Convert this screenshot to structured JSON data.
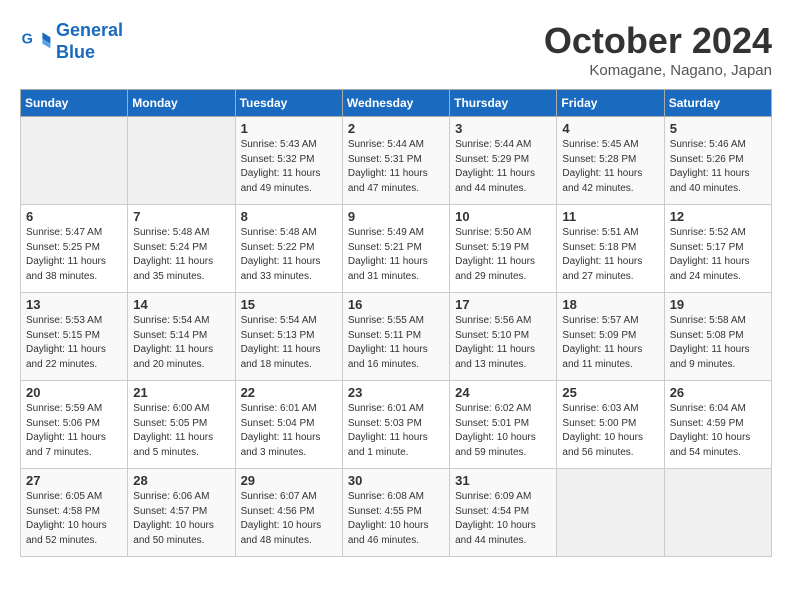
{
  "header": {
    "logo_line1": "General",
    "logo_line2": "Blue",
    "month_title": "October 2024",
    "location": "Komagane, Nagano, Japan"
  },
  "days_of_week": [
    "Sunday",
    "Monday",
    "Tuesday",
    "Wednesday",
    "Thursday",
    "Friday",
    "Saturday"
  ],
  "weeks": [
    [
      {
        "day": "",
        "content": ""
      },
      {
        "day": "",
        "content": ""
      },
      {
        "day": "1",
        "content": "Sunrise: 5:43 AM\nSunset: 5:32 PM\nDaylight: 11 hours\nand 49 minutes."
      },
      {
        "day": "2",
        "content": "Sunrise: 5:44 AM\nSunset: 5:31 PM\nDaylight: 11 hours\nand 47 minutes."
      },
      {
        "day": "3",
        "content": "Sunrise: 5:44 AM\nSunset: 5:29 PM\nDaylight: 11 hours\nand 44 minutes."
      },
      {
        "day": "4",
        "content": "Sunrise: 5:45 AM\nSunset: 5:28 PM\nDaylight: 11 hours\nand 42 minutes."
      },
      {
        "day": "5",
        "content": "Sunrise: 5:46 AM\nSunset: 5:26 PM\nDaylight: 11 hours\nand 40 minutes."
      }
    ],
    [
      {
        "day": "6",
        "content": "Sunrise: 5:47 AM\nSunset: 5:25 PM\nDaylight: 11 hours\nand 38 minutes."
      },
      {
        "day": "7",
        "content": "Sunrise: 5:48 AM\nSunset: 5:24 PM\nDaylight: 11 hours\nand 35 minutes."
      },
      {
        "day": "8",
        "content": "Sunrise: 5:48 AM\nSunset: 5:22 PM\nDaylight: 11 hours\nand 33 minutes."
      },
      {
        "day": "9",
        "content": "Sunrise: 5:49 AM\nSunset: 5:21 PM\nDaylight: 11 hours\nand 31 minutes."
      },
      {
        "day": "10",
        "content": "Sunrise: 5:50 AM\nSunset: 5:19 PM\nDaylight: 11 hours\nand 29 minutes."
      },
      {
        "day": "11",
        "content": "Sunrise: 5:51 AM\nSunset: 5:18 PM\nDaylight: 11 hours\nand 27 minutes."
      },
      {
        "day": "12",
        "content": "Sunrise: 5:52 AM\nSunset: 5:17 PM\nDaylight: 11 hours\nand 24 minutes."
      }
    ],
    [
      {
        "day": "13",
        "content": "Sunrise: 5:53 AM\nSunset: 5:15 PM\nDaylight: 11 hours\nand 22 minutes."
      },
      {
        "day": "14",
        "content": "Sunrise: 5:54 AM\nSunset: 5:14 PM\nDaylight: 11 hours\nand 20 minutes."
      },
      {
        "day": "15",
        "content": "Sunrise: 5:54 AM\nSunset: 5:13 PM\nDaylight: 11 hours\nand 18 minutes."
      },
      {
        "day": "16",
        "content": "Sunrise: 5:55 AM\nSunset: 5:11 PM\nDaylight: 11 hours\nand 16 minutes."
      },
      {
        "day": "17",
        "content": "Sunrise: 5:56 AM\nSunset: 5:10 PM\nDaylight: 11 hours\nand 13 minutes."
      },
      {
        "day": "18",
        "content": "Sunrise: 5:57 AM\nSunset: 5:09 PM\nDaylight: 11 hours\nand 11 minutes."
      },
      {
        "day": "19",
        "content": "Sunrise: 5:58 AM\nSunset: 5:08 PM\nDaylight: 11 hours\nand 9 minutes."
      }
    ],
    [
      {
        "day": "20",
        "content": "Sunrise: 5:59 AM\nSunset: 5:06 PM\nDaylight: 11 hours\nand 7 minutes."
      },
      {
        "day": "21",
        "content": "Sunrise: 6:00 AM\nSunset: 5:05 PM\nDaylight: 11 hours\nand 5 minutes."
      },
      {
        "day": "22",
        "content": "Sunrise: 6:01 AM\nSunset: 5:04 PM\nDaylight: 11 hours\nand 3 minutes."
      },
      {
        "day": "23",
        "content": "Sunrise: 6:01 AM\nSunset: 5:03 PM\nDaylight: 11 hours\nand 1 minute."
      },
      {
        "day": "24",
        "content": "Sunrise: 6:02 AM\nSunset: 5:01 PM\nDaylight: 10 hours\nand 59 minutes."
      },
      {
        "day": "25",
        "content": "Sunrise: 6:03 AM\nSunset: 5:00 PM\nDaylight: 10 hours\nand 56 minutes."
      },
      {
        "day": "26",
        "content": "Sunrise: 6:04 AM\nSunset: 4:59 PM\nDaylight: 10 hours\nand 54 minutes."
      }
    ],
    [
      {
        "day": "27",
        "content": "Sunrise: 6:05 AM\nSunset: 4:58 PM\nDaylight: 10 hours\nand 52 minutes."
      },
      {
        "day": "28",
        "content": "Sunrise: 6:06 AM\nSunset: 4:57 PM\nDaylight: 10 hours\nand 50 minutes."
      },
      {
        "day": "29",
        "content": "Sunrise: 6:07 AM\nSunset: 4:56 PM\nDaylight: 10 hours\nand 48 minutes."
      },
      {
        "day": "30",
        "content": "Sunrise: 6:08 AM\nSunset: 4:55 PM\nDaylight: 10 hours\nand 46 minutes."
      },
      {
        "day": "31",
        "content": "Sunrise: 6:09 AM\nSunset: 4:54 PM\nDaylight: 10 hours\nand 44 minutes."
      },
      {
        "day": "",
        "content": ""
      },
      {
        "day": "",
        "content": ""
      }
    ]
  ]
}
